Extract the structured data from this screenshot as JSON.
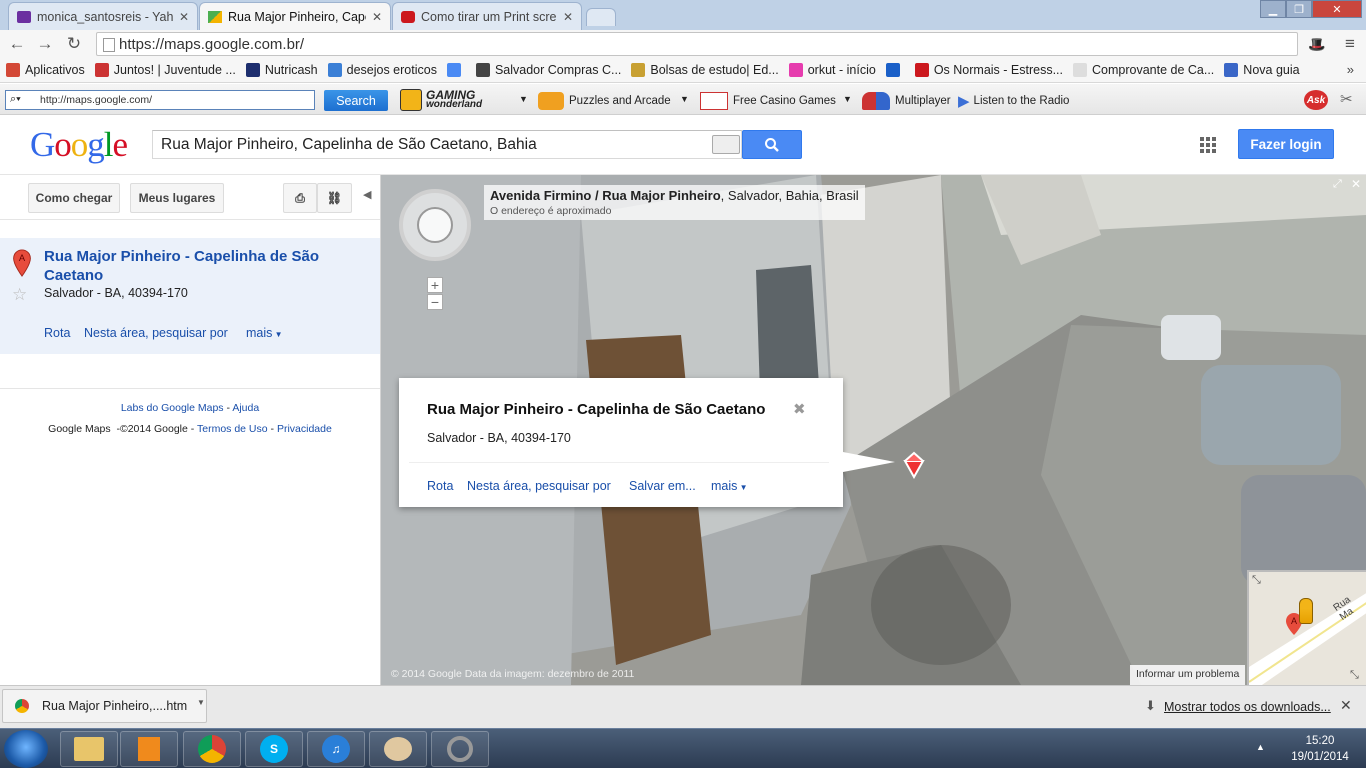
{
  "tabs": [
    {
      "label": "monica_santosreis - Yaho",
      "icon": "yahoo-mail-icon",
      "active": false
    },
    {
      "label": "Rua Major Pinheiro, Capel",
      "icon": "google-maps-icon",
      "active": true
    },
    {
      "label": "Como tirar um Print scree",
      "icon": "youtube-icon",
      "active": false
    }
  ],
  "omnibox": {
    "url": "https://maps.google.com.br/"
  },
  "bookmarks": [
    {
      "label": "Aplicativos",
      "icon": "apps-grid-icon",
      "color": "#d34836"
    },
    {
      "label": "Juntos! | Juventude ...",
      "icon": "juntos-icon",
      "color": "#cc3333"
    },
    {
      "label": "Nutricash",
      "icon": "nutricash-icon",
      "color": "#1d2e6e"
    },
    {
      "label": "desejos eroticos",
      "icon": "bookmark-site-icon",
      "color": "#3b7fd6"
    },
    {
      "label": "",
      "icon": "google-plus-icon",
      "color": "#4a8af4"
    },
    {
      "label": "Salvador Compras C...",
      "icon": "salvador-compras-icon",
      "color": "#444444"
    },
    {
      "label": "Bolsas de estudo| Ed...",
      "icon": "bolsas-icon",
      "color": "#c8a032"
    },
    {
      "label": "orkut - início",
      "icon": "orkut-icon",
      "color": "#e63cae"
    },
    {
      "label": "",
      "icon": "sixth-bookmark-icon",
      "color": "#1a5fc8"
    },
    {
      "label": "Os Normais - Estress...",
      "icon": "youtube-icon",
      "color": "#cc181e"
    },
    {
      "label": "Comprovante de Ca...",
      "icon": "document-icon",
      "color": "#dddddd"
    },
    {
      "label": "Nova guia",
      "icon": "nova-guia-icon",
      "color": "#3a66c7"
    }
  ],
  "ask_toolbar": {
    "search_value": "http://maps.google.com/",
    "search_button": "Search",
    "gaming_label": "GAMING",
    "gaming_sub": "wonderland",
    "items": [
      "Puzzles and Arcade",
      "Free Casino Games",
      "Multiplayer",
      "Listen to the Radio"
    ],
    "ask_logo": "Ask"
  },
  "google_header": {
    "logo": "Google",
    "search_value": "Rua Major Pinheiro, Capelinha de São Caetano, Bahia",
    "login_label": "Fazer login"
  },
  "left_panel": {
    "buttons": {
      "directions": "Como chegar",
      "my_places": "Meus lugares"
    },
    "result": {
      "marker": "A",
      "title": "Rua Major Pinheiro - Capelinha de São Caetano",
      "address": "Salvador - BA, 40394-170",
      "links": {
        "route": "Rota",
        "nearby": "Nesta área, pesquisar por",
        "more": "mais"
      }
    },
    "footer": {
      "labs": "Labs do Google Maps",
      "sep": " - ",
      "help": "Ajuda",
      "brand": "Google Maps",
      "copyright": "-©2014 Google",
      "terms": "Termos de Uso",
      "privacy": "Privacidade"
    }
  },
  "street_view": {
    "address_bold": "Avenida Firmino / Rua Major Pinheiro",
    "address_rest": ", Salvador, Bahia, Brasil",
    "address_note": "O endereço é aproximado",
    "copyright": "© 2014 Google    Data da imagem: dezembro de 2011",
    "report": "Informar um problema",
    "minimap_street": "Rua Ma",
    "minimap_marker": "A"
  },
  "popup": {
    "title": "Rua Major Pinheiro - Capelinha de São Caetano",
    "address": "Salvador - BA, 40394-170",
    "links": {
      "route": "Rota",
      "nearby": "Nesta área, pesquisar por",
      "save": "Salvar em...",
      "more": "mais"
    }
  },
  "download_bar": {
    "file": "Rua Major Pinheiro,....htm",
    "show_all": "Mostrar todos os downloads..."
  },
  "taskbar": {
    "apps": [
      "explorer-icon",
      "media-player-icon",
      "chrome-icon",
      "skype-icon",
      "itunes-icon",
      "paint-icon",
      "camera-app-icon"
    ],
    "time": "15:20",
    "date": "19/01/2014"
  },
  "colors": {
    "link": "#1a4faa",
    "google_blue": "#4a8af4",
    "result_bg": "#ebf1fa"
  }
}
